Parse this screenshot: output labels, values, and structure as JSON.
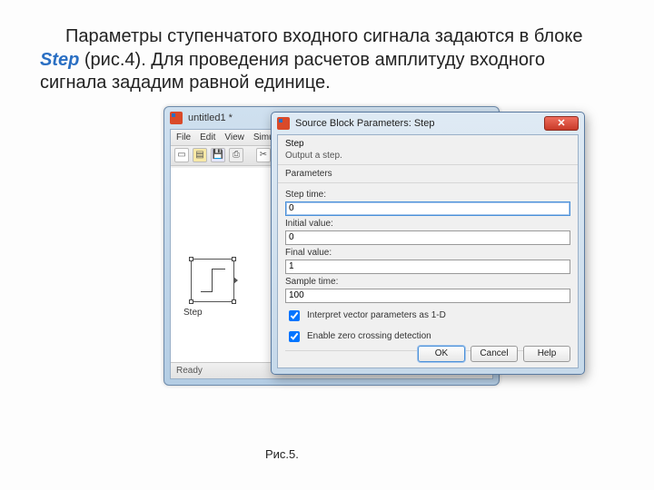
{
  "description": {
    "prefix": "Параметры ступенчатого входного сигнала задаются в блоке ",
    "step_word": "Step",
    "suffix": " (рис.4). Для проведения расчетов амплитуду входного сигнала зададим равной единице."
  },
  "caption": "Рис.5.",
  "bg_window": {
    "title": "untitled1 *",
    "menus": [
      "File",
      "Edit",
      "View",
      "Simulat"
    ],
    "block_label": "Step",
    "status_left": "Ready",
    "caption_min": "—",
    "caption_max": "▫",
    "caption_close": "×"
  },
  "dialog": {
    "title": "Source Block Parameters: Step",
    "close_glyph": "✕",
    "section_title": "Step",
    "section_sub": "Output a step.",
    "parameters_label": "Parameters",
    "fields": {
      "step_time": {
        "label": "Step time:",
        "value": "0"
      },
      "initial_value": {
        "label": "Initial value:",
        "value": "0"
      },
      "final_value": {
        "label": "Final value:",
        "value": "1"
      },
      "sample_time": {
        "label": "Sample time:",
        "value": "100"
      }
    },
    "checkbox1": "Interpret vector parameters as 1-D",
    "checkbox2": "Enable zero crossing detection",
    "buttons": {
      "ok": "OK",
      "cancel": "Cancel",
      "help": "Help"
    }
  }
}
